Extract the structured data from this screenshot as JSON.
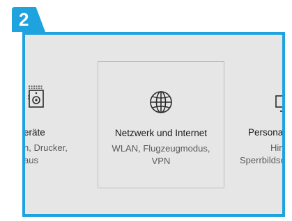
{
  "step": {
    "number": "2"
  },
  "accent_color": "#1fa3df",
  "tiles": [
    {
      "name": "geraete",
      "icon": "speaker-keyboard-icon",
      "title": "eräte",
      "desc_line1": "h, Drucker,",
      "desc_line2": "aus"
    },
    {
      "name": "netzwerk",
      "icon": "globe-icon",
      "title": "Netzwerk und Internet",
      "desc_line1": "WLAN, Flugzeugmodus,",
      "desc_line2": "VPN"
    },
    {
      "name": "personalisierung",
      "icon": "personalization-icon",
      "title": "Personal",
      "desc_line1": "Hinterg",
      "desc_line2": "Sperrbildsch"
    }
  ]
}
